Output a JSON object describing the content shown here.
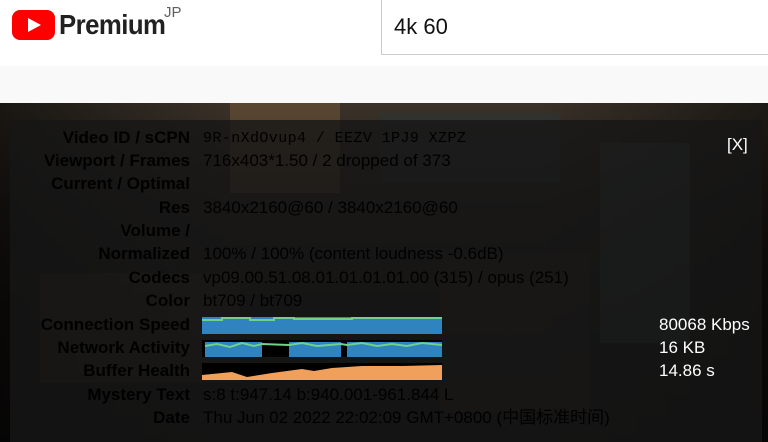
{
  "header": {
    "logo_text": "Premium",
    "region": "JP",
    "search_value": "4k 60"
  },
  "stats": {
    "close_label": "[X]",
    "rows": [
      {
        "label": "Video ID / sCPN",
        "value": "9R-nXdOvup4 / EEZV 1PJ9 XZPZ"
      },
      {
        "label": "Viewport / Frames",
        "value": "716x403*1.50 / 2 dropped of 373"
      },
      {
        "label": "Current / Optimal",
        "value": ""
      },
      {
        "label": "Res",
        "value": "3840x2160@60 / 3840x2160@60"
      },
      {
        "label": "Volume /",
        "value": ""
      },
      {
        "label": "Normalized",
        "value": "100% / 100% (content loudness -0.6dB)"
      },
      {
        "label": "Codecs",
        "value": "vp09.00.51.08.01.01.01.01.00 (315) / opus (251)"
      },
      {
        "label": "Color",
        "value": "bt709 / bt709"
      },
      {
        "label": "Connection Speed",
        "value": "80068 Kbps"
      },
      {
        "label": "Network Activity",
        "value": "16 KB"
      },
      {
        "label": "Buffer Health",
        "value": "14.86 s"
      },
      {
        "label": "Mystery Text",
        "value": "s:8 t:947.14 b:940.001-961.844 L"
      },
      {
        "label": "Date",
        "value": "Thu Jun 02 2022 22:02:09 GMT+0800 (中国标准时间)"
      }
    ],
    "colors": {
      "connection_bar": "#2f84bf",
      "connection_wave": "#6fd18a",
      "network_bar": "#2f84bf",
      "network_wave": "#6fd18a",
      "buffer_bar": "#f0a05a"
    }
  }
}
